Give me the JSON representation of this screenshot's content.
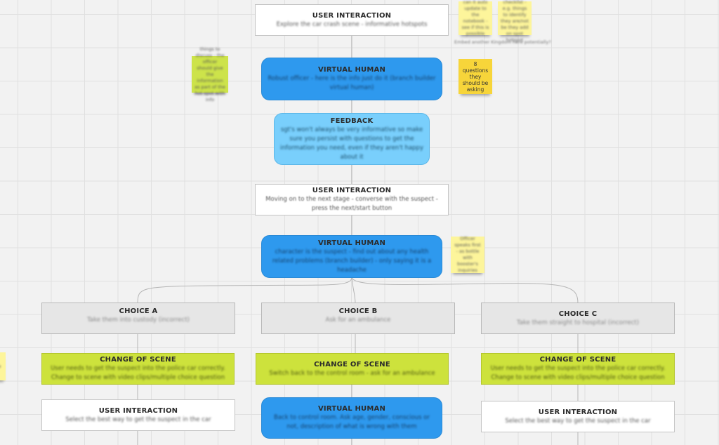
{
  "board": {
    "colors": {
      "background": "#f2f2f2",
      "grid": "#e0e0e0",
      "white_node": "#ffffff",
      "virtual_human": "#2e99ee",
      "feedback": "#79cffc",
      "choice": "#e6e6e6",
      "change_of_scene": "#cde23c",
      "sticky_yellow": "#fdf59b",
      "sticky_gold": "#f7d53a",
      "sticky_green": "#cde34a"
    },
    "nodes": {
      "user_interaction_1": {
        "title": "USER INTERACTION",
        "body": "Explore the car crash scene - informative hotspots"
      },
      "virtual_human_1": {
        "title": "VIRTUAL HUMAN",
        "body": "Robust officer - here is the info just do it (branch builder virtual human)"
      },
      "feedback": {
        "title": "FEEDBACK",
        "body": "sgt's won't always be very informative so make sure you persist with questions to get the information you need, even if they aren't happy about it"
      },
      "user_interaction_2": {
        "title": "USER INTERACTION",
        "body": "Moving on to the next stage - converse with the suspect - press the next/start button"
      },
      "virtual_human_2": {
        "title": "VIRTUAL HUMAN",
        "body": "character is the suspect - find out about any health related problems (branch builder) - only saying it is a headache"
      },
      "choice_a": {
        "title": "CHOICE A",
        "body": "Take them into custody (incorrect)"
      },
      "choice_b": {
        "title": "CHOICE B",
        "body": "Ask for an ambulance"
      },
      "choice_c": {
        "title": "CHOICE C",
        "body": "Take them straight to hospital (incorrect)"
      },
      "change_scene_a": {
        "title": "CHANGE OF SCENE",
        "body": "User needs to get the suspect into the police car correctly. Change to scene with video clips/multiple choice question"
      },
      "change_scene_b": {
        "title": "CHANGE OF SCENE",
        "body": "Switch back to the control room - ask for an ambulance"
      },
      "change_scene_c": {
        "title": "CHANGE OF SCENE",
        "body": "User needs to get the suspect into the police car correctly. Change to scene with video clips/multiple choice question"
      },
      "user_interaction_a": {
        "title": "USER INTERACTION",
        "body": "Select the best way to get the suspect in the car"
      },
      "virtual_human_b": {
        "title": "VIRTUAL HUMAN",
        "body": "Back to control room. Ask age, gender, conscious or not, description of what is wrong with them"
      },
      "user_interaction_c": {
        "title": "USER INTERACTION",
        "body": "Select the best way to get the suspect in the car"
      }
    },
    "stickies": {
      "note_top_1": "can it auto update to the notebook - see if this is possible",
      "note_top_2": "hidden checklist - e.g. things to identify they are/not be they add on spot hotspot",
      "note_top_caption": "Embed another Kingdom here potentially?",
      "note_questions": "8 questions they should be asking",
      "note_green": "things to discuss - the officer should give the information as part of the hot spot with info",
      "note_officer": "Officer speaks first - as bottle with booster's inquiries",
      "note_left_edge": "note"
    }
  }
}
